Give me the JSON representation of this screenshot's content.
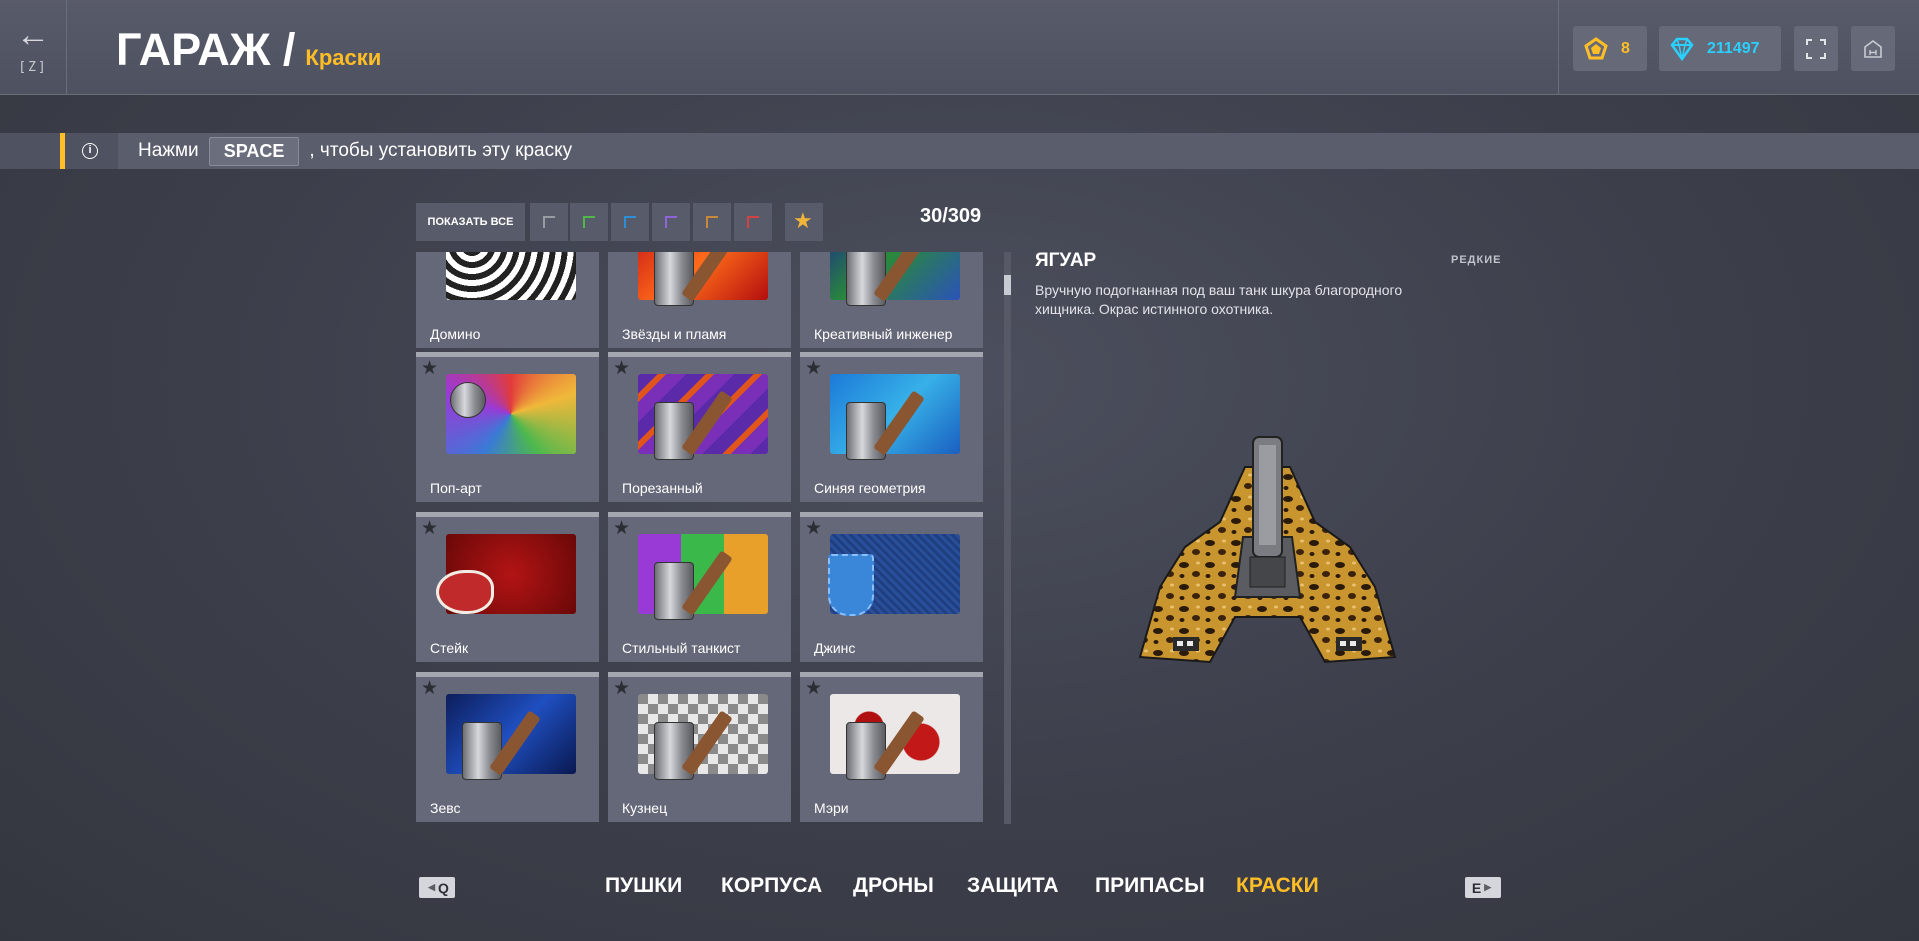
{
  "header": {
    "back_icon": "arrow-left-icon",
    "back_key": "[Z]",
    "title": "ГАРАЖ /",
    "subtitle": "Краски",
    "rank_value": "8",
    "crystals_value": "211497",
    "colors": {
      "accent": "#ffbe26",
      "crystal": "#2ad0ff"
    }
  },
  "hint": {
    "prefix": "Нажми",
    "key": "SPACE",
    "suffix": ", чтобы установить эту краску"
  },
  "filters": {
    "show_all": "ПОКАЗАТЬ ВСЕ",
    "items": [
      {
        "name": "filter-common",
        "color": "#9a9ca4"
      },
      {
        "name": "filter-uncommon",
        "color": "#4fb849"
      },
      {
        "name": "filter-rare",
        "color": "#2f8fd6"
      },
      {
        "name": "filter-epic",
        "color": "#8f64d8"
      },
      {
        "name": "filter-legendary",
        "color": "#c88a3a"
      },
      {
        "name": "filter-artefact",
        "color": "#d34242"
      },
      {
        "name": "filter-featured",
        "color": "#f0b43b"
      }
    ],
    "count": "30/309"
  },
  "paints": [
    {
      "label": "Домино"
    },
    {
      "label": "Звёзды и пламя"
    },
    {
      "label": "Креативный инженер"
    },
    {
      "label": "Поп-арт"
    },
    {
      "label": "Порезанный"
    },
    {
      "label": "Синяя геометрия"
    },
    {
      "label": "Стейк"
    },
    {
      "label": "Стильный танкист"
    },
    {
      "label": "Джинс"
    },
    {
      "label": "Зевс"
    },
    {
      "label": "Кузнец"
    },
    {
      "label": "Мэри"
    }
  ],
  "detail": {
    "name": "ЯГУАР",
    "rarity": "РЕДКИЕ",
    "description": "Вручную подогнанная под ваш танк шкура благородного хищника. Окрас истинного охотника."
  },
  "nav": {
    "prev_key": "Q",
    "next_key": "E",
    "items": [
      "ПУШКИ",
      "КОРПУСА",
      "ДРОНЫ",
      "ЗАЩИТА",
      "ПРИПАСЫ",
      "КРАСКИ"
    ],
    "active": "КРАСКИ"
  }
}
